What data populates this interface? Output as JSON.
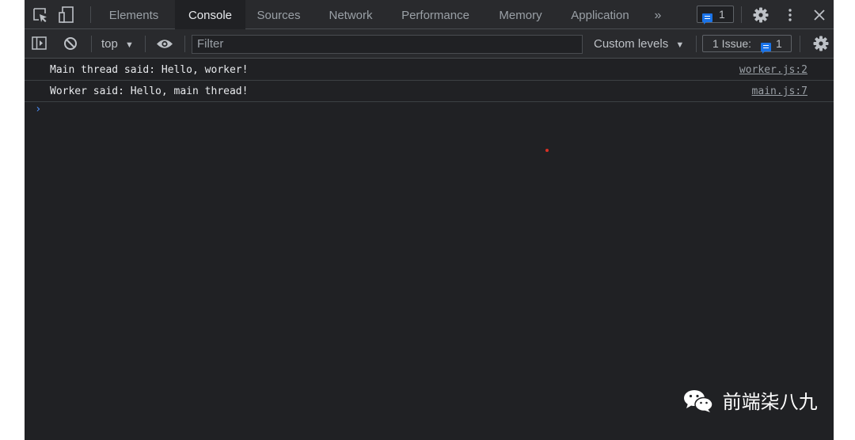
{
  "tabs": [
    {
      "label": "Elements",
      "active": false
    },
    {
      "label": "Console",
      "active": true
    },
    {
      "label": "Sources",
      "active": false
    },
    {
      "label": "Network",
      "active": false
    },
    {
      "label": "Performance",
      "active": false
    },
    {
      "label": "Memory",
      "active": false
    },
    {
      "label": "Application",
      "active": false
    }
  ],
  "more_tabs_glyph": "»",
  "message_badge_count": "1",
  "toolbar": {
    "context": "top",
    "filter_placeholder": "Filter",
    "levels": "Custom levels",
    "issues_label": "1 Issue:",
    "issues_count": "1"
  },
  "console_messages": [
    {
      "text": "Main thread said: Hello, worker!",
      "source": "worker.js:2"
    },
    {
      "text": "Worker said: Hello, main thread!",
      "source": "main.js:7"
    }
  ],
  "prompt_glyph": "›",
  "watermark": "前端柒八九",
  "colors": {
    "accent": "#1a73e8",
    "prompt": "#4a8bf5",
    "background": "#202124"
  }
}
